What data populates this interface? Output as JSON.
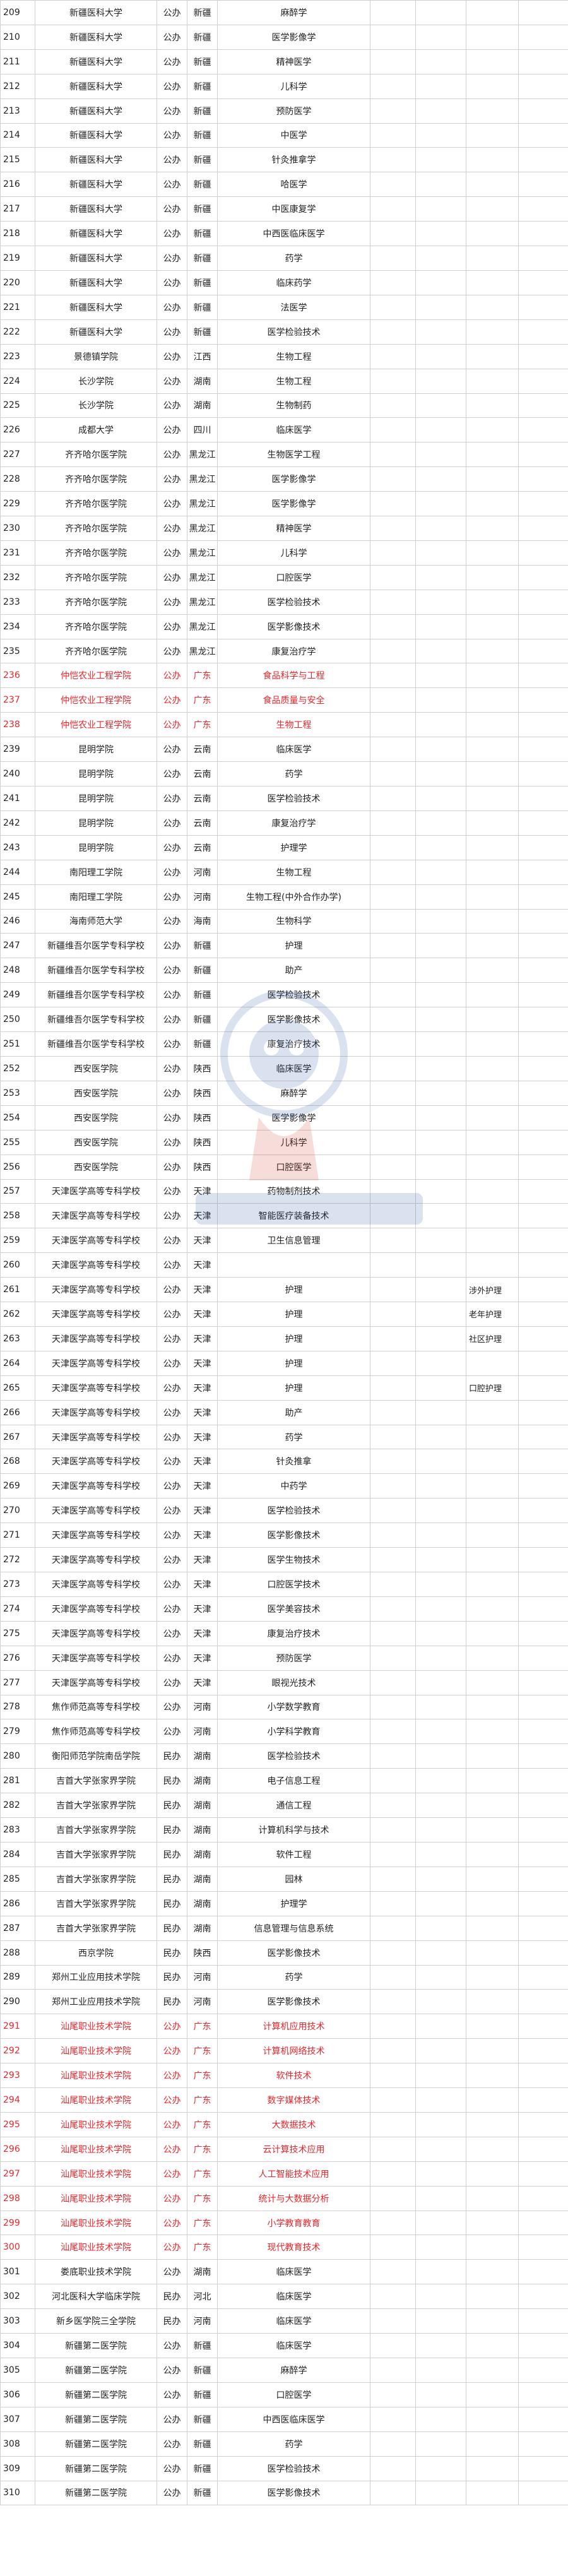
{
  "table": {
    "rows": [
      [
        "209",
        "新疆医科大学",
        "公办",
        "新疆",
        "麻醉学",
        ""
      ],
      [
        "210",
        "新疆医科大学",
        "公办",
        "新疆",
        "医学影像学",
        ""
      ],
      [
        "211",
        "新疆医科大学",
        "公办",
        "新疆",
        "精神医学",
        ""
      ],
      [
        "212",
        "新疆医科大学",
        "公办",
        "新疆",
        "儿科学",
        ""
      ],
      [
        "213",
        "新疆医科大学",
        "公办",
        "新疆",
        "预防医学",
        ""
      ],
      [
        "214",
        "新疆医科大学",
        "公办",
        "新疆",
        "中医学",
        ""
      ],
      [
        "215",
        "新疆医科大学",
        "公办",
        "新疆",
        "针灸推拿学",
        ""
      ],
      [
        "216",
        "新疆医科大学",
        "公办",
        "新疆",
        "哈医学",
        ""
      ],
      [
        "217",
        "新疆医科大学",
        "公办",
        "新疆",
        "中医康复学",
        ""
      ],
      [
        "218",
        "新疆医科大学",
        "公办",
        "新疆",
        "中西医临床医学",
        ""
      ],
      [
        "219",
        "新疆医科大学",
        "公办",
        "新疆",
        "药学",
        ""
      ],
      [
        "220",
        "新疆医科大学",
        "公办",
        "新疆",
        "临床药学",
        ""
      ],
      [
        "221",
        "新疆医科大学",
        "公办",
        "新疆",
        "法医学",
        ""
      ],
      [
        "222",
        "新疆医科大学",
        "公办",
        "新疆",
        "医学检验技术",
        ""
      ],
      [
        "223",
        "景德镇学院",
        "公办",
        "江西",
        "生物工程",
        ""
      ],
      [
        "224",
        "长沙学院",
        "公办",
        "湖南",
        "生物工程",
        ""
      ],
      [
        "225",
        "长沙学院",
        "公办",
        "湖南",
        "生物制药",
        ""
      ],
      [
        "226",
        "成都大学",
        "公办",
        "四川",
        "临床医学",
        ""
      ],
      [
        "227",
        "齐齐哈尔医学院",
        "公办",
        "黑龙江",
        "生物医学工程",
        ""
      ],
      [
        "228",
        "齐齐哈尔医学院",
        "公办",
        "黑龙江",
        "医学影像学",
        ""
      ],
      [
        "229",
        "齐齐哈尔医学院",
        "公办",
        "黑龙江",
        "医学影像学",
        ""
      ],
      [
        "230",
        "齐齐哈尔医学院",
        "公办",
        "黑龙江",
        "精神医学",
        ""
      ],
      [
        "231",
        "齐齐哈尔医学院",
        "公办",
        "黑龙江",
        "儿科学",
        ""
      ],
      [
        "232",
        "齐齐哈尔医学院",
        "公办",
        "黑龙江",
        "口腔医学",
        ""
      ],
      [
        "233",
        "齐齐哈尔医学院",
        "公办",
        "黑龙江",
        "医学检验技术",
        ""
      ],
      [
        "234",
        "齐齐哈尔医学院",
        "公办",
        "黑龙江",
        "医学影像技术",
        ""
      ],
      [
        "235",
        "齐齐哈尔医学院",
        "公办",
        "黑龙江",
        "康复治疗学",
        ""
      ],
      [
        "236",
        "仲恺农业工程学院",
        "公办",
        "广东",
        "食品科学与工程",
        ""
      ],
      [
        "237",
        "仲恺农业工程学院",
        "公办",
        "广东",
        "食品质量与安全",
        ""
      ],
      [
        "238",
        "仲恺农业工程学院",
        "公办",
        "广东",
        "生物工程",
        ""
      ],
      [
        "239",
        "昆明学院",
        "公办",
        "云南",
        "临床医学",
        ""
      ],
      [
        "240",
        "昆明学院",
        "公办",
        "云南",
        "药学",
        ""
      ],
      [
        "241",
        "昆明学院",
        "公办",
        "云南",
        "医学检验技术",
        ""
      ],
      [
        "242",
        "昆明学院",
        "公办",
        "云南",
        "康复治疗学",
        ""
      ],
      [
        "243",
        "昆明学院",
        "公办",
        "云南",
        "护理学",
        ""
      ],
      [
        "244",
        "南阳理工学院",
        "公办",
        "河南",
        "生物工程",
        ""
      ],
      [
        "245",
        "南阳理工学院",
        "公办",
        "河南",
        "生物工程(中外合作办学)",
        ""
      ],
      [
        "246",
        "海南师范大学",
        "公办",
        "海南",
        "生物科学",
        ""
      ],
      [
        "247",
        "新疆维吾尔医学专科学校",
        "公办",
        "新疆",
        "护理",
        ""
      ],
      [
        "248",
        "新疆维吾尔医学专科学校",
        "公办",
        "新疆",
        "助产",
        ""
      ],
      [
        "249",
        "新疆维吾尔医学专科学校",
        "公办",
        "新疆",
        "医学检验技术",
        ""
      ],
      [
        "250",
        "新疆维吾尔医学专科学校",
        "公办",
        "新疆",
        "医学影像技术",
        ""
      ],
      [
        "251",
        "新疆维吾尔医学专科学校",
        "公办",
        "新疆",
        "康复治疗技术",
        ""
      ],
      [
        "252",
        "西安医学院",
        "公办",
        "陕西",
        "临床医学",
        ""
      ],
      [
        "253",
        "西安医学院",
        "公办",
        "陕西",
        "麻醉学",
        ""
      ],
      [
        "254",
        "西安医学院",
        "公办",
        "陕西",
        "医学影像学",
        ""
      ],
      [
        "255",
        "西安医学院",
        "公办",
        "陕西",
        "儿科学",
        ""
      ],
      [
        "256",
        "西安医学院",
        "公办",
        "陕西",
        "口腔医学",
        ""
      ],
      [
        "257",
        "天津医学高等专科学校",
        "公办",
        "天津",
        "药物制剂技术",
        ""
      ],
      [
        "258",
        "天津医学高等专科学校",
        "公办",
        "天津",
        "智能医疗装备技术",
        ""
      ],
      [
        "259",
        "天津医学高等专科学校",
        "公办",
        "天津",
        "卫生信息管理",
        ""
      ],
      [
        "260",
        "天津医学高等专科学校",
        "公办",
        "天津",
        "",
        ""
      ],
      [
        "261",
        "天津医学高等专科学校",
        "公办",
        "天津",
        "护理",
        "涉外护理"
      ],
      [
        "262",
        "天津医学高等专科学校",
        "公办",
        "天津",
        "护理",
        "老年护理"
      ],
      [
        "263",
        "天津医学高等专科学校",
        "公办",
        "天津",
        "护理",
        "社区护理"
      ],
      [
        "264",
        "天津医学高等专科学校",
        "公办",
        "天津",
        "护理",
        ""
      ],
      [
        "265",
        "天津医学高等专科学校",
        "公办",
        "天津",
        "护理",
        "口腔护理"
      ],
      [
        "266",
        "天津医学高等专科学校",
        "公办",
        "天津",
        "助产",
        ""
      ],
      [
        "267",
        "天津医学高等专科学校",
        "公办",
        "天津",
        "药学",
        ""
      ],
      [
        "268",
        "天津医学高等专科学校",
        "公办",
        "天津",
        "针灸推拿",
        ""
      ],
      [
        "269",
        "天津医学高等专科学校",
        "公办",
        "天津",
        "中药学",
        ""
      ],
      [
        "270",
        "天津医学高等专科学校",
        "公办",
        "天津",
        "医学检验技术",
        ""
      ],
      [
        "271",
        "天津医学高等专科学校",
        "公办",
        "天津",
        "医学影像技术",
        ""
      ],
      [
        "272",
        "天津医学高等专科学校",
        "公办",
        "天津",
        "医学生物技术",
        ""
      ],
      [
        "273",
        "天津医学高等专科学校",
        "公办",
        "天津",
        "口腔医学技术",
        ""
      ],
      [
        "274",
        "天津医学高等专科学校",
        "公办",
        "天津",
        "医学美容技术",
        ""
      ],
      [
        "275",
        "天津医学高等专科学校",
        "公办",
        "天津",
        "康复治疗技术",
        ""
      ],
      [
        "276",
        "天津医学高等专科学校",
        "公办",
        "天津",
        "预防医学",
        ""
      ],
      [
        "277",
        "天津医学高等专科学校",
        "公办",
        "天津",
        "眼视光技术",
        ""
      ],
      [
        "278",
        "焦作师范高等专科学校",
        "公办",
        "河南",
        "小学数学教育",
        ""
      ],
      [
        "279",
        "焦作师范高等专科学校",
        "公办",
        "河南",
        "小学科学教育",
        ""
      ],
      [
        "280",
        "衡阳师范学院南岳学院",
        "民办",
        "湖南",
        "医学检验技术",
        ""
      ],
      [
        "281",
        "吉首大学张家界学院",
        "民办",
        "湖南",
        "电子信息工程",
        ""
      ],
      [
        "282",
        "吉首大学张家界学院",
        "民办",
        "湖南",
        "通信工程",
        ""
      ],
      [
        "283",
        "吉首大学张家界学院",
        "民办",
        "湖南",
        "计算机科学与技术",
        ""
      ],
      [
        "284",
        "吉首大学张家界学院",
        "民办",
        "湖南",
        "软件工程",
        ""
      ],
      [
        "285",
        "吉首大学张家界学院",
        "民办",
        "湖南",
        "园林",
        ""
      ],
      [
        "286",
        "吉首大学张家界学院",
        "民办",
        "湖南",
        "护理学",
        ""
      ],
      [
        "287",
        "吉首大学张家界学院",
        "民办",
        "湖南",
        "信息管理与信息系统",
        ""
      ],
      [
        "288",
        "西京学院",
        "民办",
        "陕西",
        "医学影像技术",
        ""
      ],
      [
        "289",
        "郑州工业应用技术学院",
        "民办",
        "河南",
        "药学",
        ""
      ],
      [
        "290",
        "郑州工业应用技术学院",
        "民办",
        "河南",
        "医学影像技术",
        ""
      ],
      [
        "291",
        "汕尾职业技术学院",
        "公办",
        "广东",
        "计算机应用技术",
        ""
      ],
      [
        "292",
        "汕尾职业技术学院",
        "公办",
        "广东",
        "计算机网络技术",
        ""
      ],
      [
        "293",
        "汕尾职业技术学院",
        "公办",
        "广东",
        "软件技术",
        ""
      ],
      [
        "294",
        "汕尾职业技术学院",
        "公办",
        "广东",
        "数字媒体技术",
        ""
      ],
      [
        "295",
        "汕尾职业技术学院",
        "公办",
        "广东",
        "大数据技术",
        ""
      ],
      [
        "296",
        "汕尾职业技术学院",
        "公办",
        "广东",
        "云计算技术应用",
        ""
      ],
      [
        "297",
        "汕尾职业技术学院",
        "公办",
        "广东",
        "人工智能技术应用",
        ""
      ],
      [
        "298",
        "汕尾职业技术学院",
        "公办",
        "广东",
        "统计与大数据分析",
        ""
      ],
      [
        "299",
        "汕尾职业技术学院",
        "公办",
        "广东",
        "小学教育教育",
        ""
      ],
      [
        "300",
        "汕尾职业技术学院",
        "公办",
        "广东",
        "现代教育技术",
        ""
      ],
      [
        "301",
        "娄底职业技术学院",
        "公办",
        "湖南",
        "临床医学",
        ""
      ],
      [
        "302",
        "河北医科大学临床学院",
        "民办",
        "河北",
        "临床医学",
        ""
      ],
      [
        "303",
        "新乡医学院三全学院",
        "民办",
        "河南",
        "临床医学",
        ""
      ],
      [
        "304",
        "新疆第二医学院",
        "公办",
        "新疆",
        "临床医学",
        ""
      ],
      [
        "305",
        "新疆第二医学院",
        "公办",
        "新疆",
        "麻醉学",
        ""
      ],
      [
        "306",
        "新疆第二医学院",
        "公办",
        "新疆",
        "口腔医学",
        ""
      ],
      [
        "307",
        "新疆第二医学院",
        "公办",
        "新疆",
        "中西医临床医学",
        ""
      ],
      [
        "308",
        "新疆第二医学院",
        "公办",
        "新疆",
        "药学",
        ""
      ],
      [
        "309",
        "新疆第二医学院",
        "公办",
        "新疆",
        "医学检验技术",
        ""
      ],
      [
        "310",
        "新疆第二医学院",
        "公办",
        "新疆",
        "医学影像技术",
        ""
      ]
    ],
    "highlight_color": "#e8262b",
    "highlight_rows": [
      "236",
      "237",
      "238",
      "291",
      "292",
      "293",
      "294",
      "295",
      "296",
      "297",
      "298",
      "299",
      "300"
    ]
  }
}
